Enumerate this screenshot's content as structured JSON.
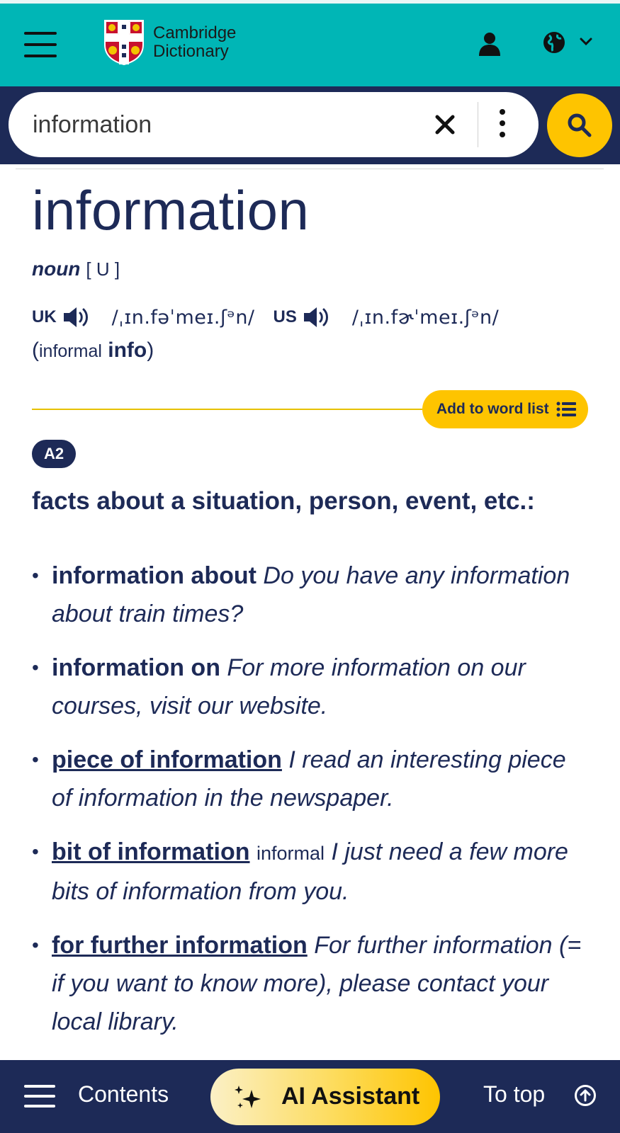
{
  "header": {
    "logo_line1": "Cambridge",
    "logo_line2": "Dictionary",
    "menu_icon": "hamburger-menu-icon",
    "user_icon": "user-icon",
    "language_icon": "globe-icon"
  },
  "search": {
    "value": "information",
    "clear_icon": "close-icon",
    "options_icon": "vertical-dots-icon",
    "search_icon": "search-icon"
  },
  "entry": {
    "headword": "information",
    "pos": "noun",
    "grammar": "[ U ]",
    "uk_label": "UK",
    "uk_ipa": "/ˌɪn.fəˈmeɪ.ʃᵊn/",
    "us_label": "US",
    "us_ipa": "/ˌɪn.fɚˈmeɪ.ʃᵊn/",
    "variant_open": "(",
    "variant_label": "informal",
    "variant_word": "info",
    "variant_close": ")",
    "word_list_button": "Add to word list",
    "level": "A2",
    "definition": "facts about a situation, person, event, etc.:",
    "examples": [
      {
        "phrase": "information about",
        "register": "",
        "sentence": "Do you have any information about train times?"
      },
      {
        "phrase": "information on",
        "register": "",
        "sentence": "For more information on our courses, visit our website."
      },
      {
        "phrase": "piece of information",
        "register": "",
        "sentence": "I read an interesting piece of information in the newspaper."
      },
      {
        "phrase": "bit of information",
        "register": "informal",
        "sentence": "I just need a few more bits of information from you."
      },
      {
        "phrase": "for further information",
        "register": "",
        "sentence": "For further information (= if you want to know more), please contact your local library."
      }
    ]
  },
  "bottom_bar": {
    "contents_label": "Contents",
    "ai_label": "AI Assistant",
    "top_label": "To top"
  },
  "colors": {
    "teal": "#00b6b6",
    "navy": "#1d2a57",
    "yellow": "#fec400"
  }
}
